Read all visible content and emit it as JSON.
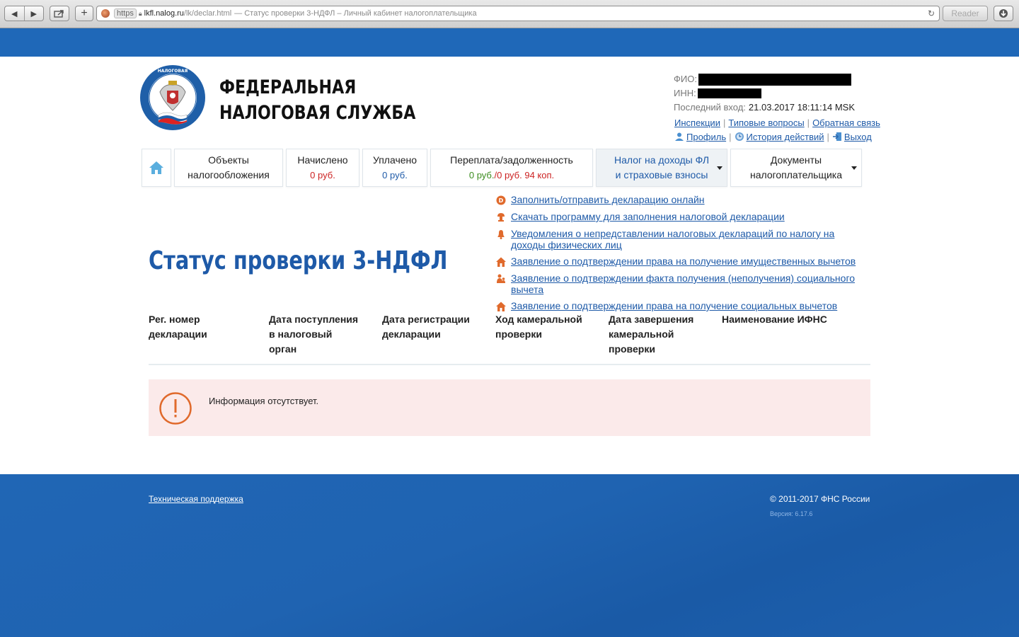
{
  "browser": {
    "https_label": "https",
    "host": "lkfl.nalog.ru",
    "path": "/lk/declar.html",
    "title": "— Статус проверки 3-НДФЛ – Личный кабинет налогоплательщика",
    "reader_label": "Reader"
  },
  "header": {
    "brand_line1": "ФЕДЕРАЛЬНАЯ",
    "brand_line2": "НАЛОГОВАЯ СЛУЖБА",
    "fio_label": "ФИО:",
    "inn_label": "ИНН:",
    "last_login_label": "Последний вход:",
    "last_login_value": "21.03.2017 18:11:14 MSK",
    "link_inspections": "Инспекции",
    "link_faq": "Типовые вопросы",
    "link_feedback": "Обратная связь",
    "link_profile": "Профиль",
    "link_history": "История действий",
    "link_logout": "Выход"
  },
  "nav": {
    "tabs": [
      {
        "line1": "Объекты",
        "line2": "налогообложения"
      },
      {
        "line1": "Начислено",
        "line2": "0 руб."
      },
      {
        "line1": "Уплачено",
        "line2": "0 руб."
      },
      {
        "line1": "Переплата/задолженность",
        "line2a": "0 руб.",
        "line2b": "/0 руб. 94 коп."
      },
      {
        "line1": "Налог на доходы ФЛ",
        "line2": "и страховые взносы"
      },
      {
        "line1": "Документы",
        "line2": "налогоплательщика"
      }
    ]
  },
  "side_links": [
    "Заполнить/отправить декларацию онлайн",
    "Скачать программу для заполнения налоговой декларации",
    "Уведомления о непредставлении налоговых деклараций по налогу на доходы физических лиц",
    "Заявление о подтверждении права на получение имущественных вычетов",
    "Заявление о подтверждении факта получения (неполучения) социального вычета",
    "Заявление о подтверждении права на получение социальных вычетов"
  ],
  "page_title": "Статус проверки 3-НДФЛ",
  "table": {
    "headers": [
      [
        "Рег. номер",
        "декларации"
      ],
      [
        "Дата поступления",
        "в налоговый",
        "орган"
      ],
      [
        "Дата регистрации",
        "декларации"
      ],
      [
        "Ход камеральной",
        "проверки"
      ],
      [
        "Дата завершения",
        "камеральной",
        "проверки"
      ],
      [
        "Наименование ИФНС"
      ]
    ]
  },
  "alert": {
    "message": "Информация отсутствует.",
    "color": "#e06a2c"
  },
  "footer": {
    "support": "Техническая поддержка",
    "copyright": "© 2011-2017 ФНС России",
    "version": "Версия: 6.17.6"
  },
  "colors": {
    "accent": "#1e5aa8",
    "band": "#1f68b8",
    "alert_bg": "#fbeaea",
    "icon_orange": "#e06a2c"
  }
}
